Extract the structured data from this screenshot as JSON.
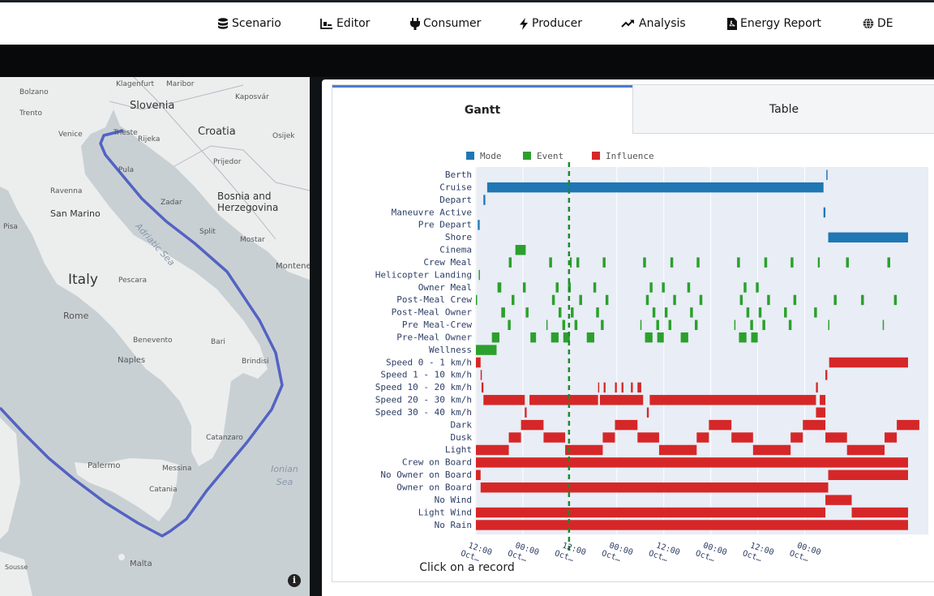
{
  "nav": {
    "items": [
      {
        "label": "Scenario",
        "icon": "database-icon"
      },
      {
        "label": "Editor",
        "icon": "chart-editor-icon"
      },
      {
        "label": "Consumer",
        "icon": "plug-icon"
      },
      {
        "label": "Producer",
        "icon": "bolt-icon"
      },
      {
        "label": "Analysis",
        "icon": "trend-icon"
      },
      {
        "label": "Energy Report",
        "icon": "pdf-file-icon"
      },
      {
        "label": "DE",
        "icon": "globe-icon"
      }
    ]
  },
  "map": {
    "labels": [
      "Klagenfurt",
      "Maribor",
      "Bolzano",
      "Trento",
      "Slovenia",
      "Kaposvár",
      "Croatia",
      "Osijek",
      "Venice",
      "Trieste",
      "Rijeka",
      "Prijedor",
      "Pula",
      "Ravenna",
      "Zadar",
      "Bosnia and Herzegovina",
      "San Marino",
      "Adriatic Sea",
      "Split",
      "Mostar",
      "Pisa",
      "Montenegro",
      "Italy",
      "Pescara",
      "Rome",
      "Benevento",
      "Bari",
      "Naples",
      "Brindisi",
      "Catanzaro",
      "Palermo",
      "Messina",
      "Ionian Sea",
      "Catania",
      "Malta",
      "Sousse"
    ],
    "route_color": "#5363c2",
    "info_icon": "info-icon"
  },
  "tabs": {
    "gantt": "Gantt",
    "table": "Table"
  },
  "chart_data": {
    "type": "gantt",
    "legend": [
      {
        "name": "Mode",
        "color": "#1f77b4"
      },
      {
        "name": "Event",
        "color": "#2ca02c"
      },
      {
        "name": "Influence",
        "color": "#d62728"
      }
    ],
    "legend_placement": "top",
    "categories": [
      "Berth",
      "Cruise",
      "Depart",
      "Maneuvre Active",
      "Pre Depart",
      "Shore",
      "Cinema",
      "Crew Meal",
      "Helicopter Landing",
      "Owner Meal",
      "Post-Meal Crew",
      "Post-Meal Owner",
      "Pre Meal-Crew",
      "Pre-Meal Owner",
      "Wellness",
      "Speed 0 - 1 km/h",
      "Speed 1 - 10 km/h",
      "Speed 10 - 20 km/h",
      "Speed 20 - 30 km/h",
      "Speed 30 - 40 km/h",
      "Dark",
      "Dusk",
      "Light",
      "Crew on Board",
      "No Owner on Board",
      "Owner on Board",
      "No Wind",
      "Light Wind",
      "No Rain"
    ],
    "x_ticks": [
      "12:00 Oct…",
      "00:00 Oct…",
      "12:00 Oct…",
      "00:00 Oct…",
      "12:00 Oct…",
      "00:00 Oct…",
      "12:00 Oct…",
      "00:00 Oct…"
    ],
    "marker_tick": "12:00 Oct…",
    "grid": true,
    "tasks": [
      {
        "row": "Berth",
        "type": "Mode",
        "start": 3.73,
        "end": 3.74
      },
      {
        "row": "Cruise",
        "type": "Mode",
        "start": 0.12,
        "end": 3.7
      },
      {
        "row": "Depart",
        "type": "Mode",
        "start": 0.08,
        "end": 0.1
      },
      {
        "row": "Maneuvre Active",
        "type": "Mode",
        "start": 3.7,
        "end": 3.72
      },
      {
        "row": "Pre Depart",
        "type": "Mode",
        "start": 0.02,
        "end": 0.04
      },
      {
        "row": "Shore",
        "type": "Mode",
        "start": 3.75,
        "end": 4.6
      },
      {
        "row": "Cinema",
        "type": "Event",
        "start": 0.42,
        "end": 0.53
      },
      {
        "row": "Crew Meal",
        "type": "Event",
        "start": 0.35,
        "end": 0.38
      },
      {
        "row": "Crew Meal",
        "type": "Event",
        "start": 0.78,
        "end": 0.81
      },
      {
        "row": "Crew Meal",
        "type": "Event",
        "start": 1.0,
        "end": 1.02
      },
      {
        "row": "Crew Meal",
        "type": "Event",
        "start": 1.07,
        "end": 1.1
      },
      {
        "row": "Crew Meal",
        "type": "Event",
        "start": 1.35,
        "end": 1.38
      },
      {
        "row": "Crew Meal",
        "type": "Event",
        "start": 1.78,
        "end": 1.81
      },
      {
        "row": "Crew Meal",
        "type": "Event",
        "start": 2.07,
        "end": 2.1
      },
      {
        "row": "Crew Meal",
        "type": "Event",
        "start": 2.35,
        "end": 2.38
      },
      {
        "row": "Crew Meal",
        "type": "Event",
        "start": 2.78,
        "end": 2.81
      },
      {
        "row": "Crew Meal",
        "type": "Event",
        "start": 3.07,
        "end": 3.1
      },
      {
        "row": "Crew Meal",
        "type": "Event",
        "start": 3.35,
        "end": 3.38
      },
      {
        "row": "Crew Meal",
        "type": "Event",
        "start": 3.64,
        "end": 3.66
      },
      {
        "row": "Crew Meal",
        "type": "Event",
        "start": 3.94,
        "end": 3.97
      },
      {
        "row": "Crew Meal",
        "type": "Event",
        "start": 4.38,
        "end": 4.41
      },
      {
        "row": "Helicopter Landing",
        "type": "Event",
        "start": 0.03,
        "end": 0.04
      },
      {
        "row": "Owner Meal",
        "type": "Event",
        "start": 0.23,
        "end": 0.27
      },
      {
        "row": "Owner Meal",
        "type": "Event",
        "start": 0.5,
        "end": 0.53
      },
      {
        "row": "Owner Meal",
        "type": "Event",
        "start": 0.85,
        "end": 0.88
      },
      {
        "row": "Owner Meal",
        "type": "Event",
        "start": 0.98,
        "end": 1.01
      },
      {
        "row": "Owner Meal",
        "type": "Event",
        "start": 1.25,
        "end": 1.28
      },
      {
        "row": "Owner Meal",
        "type": "Event",
        "start": 1.85,
        "end": 1.88
      },
      {
        "row": "Owner Meal",
        "type": "Event",
        "start": 1.98,
        "end": 2.01
      },
      {
        "row": "Owner Meal",
        "type": "Event",
        "start": 2.25,
        "end": 2.28
      },
      {
        "row": "Owner Meal",
        "type": "Event",
        "start": 2.85,
        "end": 2.88
      },
      {
        "row": "Owner Meal",
        "type": "Event",
        "start": 2.98,
        "end": 3.01
      },
      {
        "row": "Post-Meal Crew",
        "type": "Event",
        "start": 0.0,
        "end": 0.01
      },
      {
        "row": "Post-Meal Crew",
        "type": "Event",
        "start": 0.38,
        "end": 0.41
      },
      {
        "row": "Post-Meal Crew",
        "type": "Event",
        "start": 0.81,
        "end": 0.84
      },
      {
        "row": "Post-Meal Crew",
        "type": "Event",
        "start": 1.1,
        "end": 1.13
      },
      {
        "row": "Post-Meal Crew",
        "type": "Event",
        "start": 1.38,
        "end": 1.41
      },
      {
        "row": "Post-Meal Crew",
        "type": "Event",
        "start": 1.81,
        "end": 1.84
      },
      {
        "row": "Post-Meal Crew",
        "type": "Event",
        "start": 2.1,
        "end": 2.13
      },
      {
        "row": "Post-Meal Crew",
        "type": "Event",
        "start": 2.38,
        "end": 2.41
      },
      {
        "row": "Post-Meal Crew",
        "type": "Event",
        "start": 2.81,
        "end": 2.84
      },
      {
        "row": "Post-Meal Crew",
        "type": "Event",
        "start": 3.1,
        "end": 3.13
      },
      {
        "row": "Post-Meal Crew",
        "type": "Event",
        "start": 3.38,
        "end": 3.41
      },
      {
        "row": "Post-Meal Crew",
        "type": "Event",
        "start": 3.81,
        "end": 3.84
      },
      {
        "row": "Post-Meal Crew",
        "type": "Event",
        "start": 4.1,
        "end": 4.13
      },
      {
        "row": "Post-Meal Crew",
        "type": "Event",
        "start": 4.45,
        "end": 4.48
      },
      {
        "row": "Post-Meal Owner",
        "type": "Event",
        "start": 0.27,
        "end": 0.31
      },
      {
        "row": "Post-Meal Owner",
        "type": "Event",
        "start": 0.53,
        "end": 0.56
      },
      {
        "row": "Post-Meal Owner",
        "type": "Event",
        "start": 0.88,
        "end": 0.91
      },
      {
        "row": "Post-Meal Owner",
        "type": "Event",
        "start": 1.01,
        "end": 1.04
      },
      {
        "row": "Post-Meal Owner",
        "type": "Event",
        "start": 1.28,
        "end": 1.31
      },
      {
        "row": "Post-Meal Owner",
        "type": "Event",
        "start": 1.88,
        "end": 1.91
      },
      {
        "row": "Post-Meal Owner",
        "type": "Event",
        "start": 2.01,
        "end": 2.04
      },
      {
        "row": "Post-Meal Owner",
        "type": "Event",
        "start": 2.28,
        "end": 2.31
      },
      {
        "row": "Post-Meal Owner",
        "type": "Event",
        "start": 2.88,
        "end": 2.91
      },
      {
        "row": "Post-Meal Owner",
        "type": "Event",
        "start": 3.01,
        "end": 3.04
      },
      {
        "row": "Post-Meal Owner",
        "type": "Event",
        "start": 3.28,
        "end": 3.31
      },
      {
        "row": "Post-Meal Owner",
        "type": "Event",
        "start": 3.6,
        "end": 3.63
      },
      {
        "row": "Pre Meal-Crew",
        "type": "Event",
        "start": 0.34,
        "end": 0.37
      },
      {
        "row": "Pre Meal-Crew",
        "type": "Event",
        "start": 0.75,
        "end": 0.76
      },
      {
        "row": "Pre Meal-Crew",
        "type": "Event",
        "start": 0.92,
        "end": 0.95
      },
      {
        "row": "Pre Meal-Crew",
        "type": "Event",
        "start": 1.05,
        "end": 1.08
      },
      {
        "row": "Pre Meal-Crew",
        "type": "Event",
        "start": 1.33,
        "end": 1.36
      },
      {
        "row": "Pre Meal-Crew",
        "type": "Event",
        "start": 1.75,
        "end": 1.76
      },
      {
        "row": "Pre Meal-Crew",
        "type": "Event",
        "start": 1.92,
        "end": 1.95
      },
      {
        "row": "Pre Meal-Crew",
        "type": "Event",
        "start": 2.05,
        "end": 2.08
      },
      {
        "row": "Pre Meal-Crew",
        "type": "Event",
        "start": 2.33,
        "end": 2.36
      },
      {
        "row": "Pre Meal-Crew",
        "type": "Event",
        "start": 2.75,
        "end": 2.76
      },
      {
        "row": "Pre Meal-Crew",
        "type": "Event",
        "start": 2.92,
        "end": 2.95
      },
      {
        "row": "Pre Meal-Crew",
        "type": "Event",
        "start": 3.05,
        "end": 3.08
      },
      {
        "row": "Pre Meal-Crew",
        "type": "Event",
        "start": 3.33,
        "end": 3.36
      },
      {
        "row": "Pre Meal-Crew",
        "type": "Event",
        "start": 3.75,
        "end": 3.76
      },
      {
        "row": "Pre Meal-Crew",
        "type": "Event",
        "start": 4.33,
        "end": 4.34
      },
      {
        "row": "Pre-Meal Owner",
        "type": "Event",
        "start": 0.17,
        "end": 0.25
      },
      {
        "row": "Pre-Meal Owner",
        "type": "Event",
        "start": 0.58,
        "end": 0.64
      },
      {
        "row": "Pre-Meal Owner",
        "type": "Event",
        "start": 0.8,
        "end": 0.88
      },
      {
        "row": "Pre-Meal Owner",
        "type": "Event",
        "start": 0.93,
        "end": 1.0
      },
      {
        "row": "Pre-Meal Owner",
        "type": "Event",
        "start": 1.18,
        "end": 1.26
      },
      {
        "row": "Pre-Meal Owner",
        "type": "Event",
        "start": 1.8,
        "end": 1.88
      },
      {
        "row": "Pre-Meal Owner",
        "type": "Event",
        "start": 1.93,
        "end": 2.0
      },
      {
        "row": "Pre-Meal Owner",
        "type": "Event",
        "start": 2.18,
        "end": 2.26
      },
      {
        "row": "Pre-Meal Owner",
        "type": "Event",
        "start": 2.8,
        "end": 2.88
      },
      {
        "row": "Pre-Meal Owner",
        "type": "Event",
        "start": 2.93,
        "end": 3.0
      },
      {
        "row": "Wellness",
        "type": "Event",
        "start": 0.0,
        "end": 0.22
      },
      {
        "row": "Speed 0 - 1 km/h",
        "type": "Influence",
        "start": 0.0,
        "end": 0.05
      },
      {
        "row": "Speed 0 - 1 km/h",
        "type": "Influence",
        "start": 3.76,
        "end": 4.6
      },
      {
        "row": "Speed 1 - 10 km/h",
        "type": "Influence",
        "start": 0.05,
        "end": 0.06
      },
      {
        "row": "Speed 1 - 10 km/h",
        "type": "Influence",
        "start": 3.72,
        "end": 3.74
      },
      {
        "row": "Speed 10 - 20 km/h",
        "type": "Influence",
        "start": 0.06,
        "end": 0.08
      },
      {
        "row": "Speed 10 - 20 km/h",
        "type": "Influence",
        "start": 1.3,
        "end": 1.31
      },
      {
        "row": "Speed 10 - 20 km/h",
        "type": "Influence",
        "start": 1.36,
        "end": 1.38
      },
      {
        "row": "Speed 10 - 20 km/h",
        "type": "Influence",
        "start": 1.48,
        "end": 1.5
      },
      {
        "row": "Speed 10 - 20 km/h",
        "type": "Influence",
        "start": 1.55,
        "end": 1.57
      },
      {
        "row": "Speed 10 - 20 km/h",
        "type": "Influence",
        "start": 1.65,
        "end": 1.67
      },
      {
        "row": "Speed 10 - 20 km/h",
        "type": "Influence",
        "start": 1.72,
        "end": 1.76
      },
      {
        "row": "Speed 10 - 20 km/h",
        "type": "Influence",
        "start": 3.62,
        "end": 3.64
      },
      {
        "row": "Speed 20 - 30 km/h",
        "type": "Influence",
        "start": 0.08,
        "end": 0.52
      },
      {
        "row": "Speed 20 - 30 km/h",
        "type": "Influence",
        "start": 0.57,
        "end": 1.3
      },
      {
        "row": "Speed 20 - 30 km/h",
        "type": "Influence",
        "start": 1.32,
        "end": 1.78
      },
      {
        "row": "Speed 20 - 30 km/h",
        "type": "Influence",
        "start": 1.85,
        "end": 3.62
      },
      {
        "row": "Speed 20 - 30 km/h",
        "type": "Influence",
        "start": 3.66,
        "end": 3.72
      },
      {
        "row": "Speed 30 - 40 km/h",
        "type": "Influence",
        "start": 0.52,
        "end": 0.54
      },
      {
        "row": "Speed 30 - 40 km/h",
        "type": "Influence",
        "start": 1.82,
        "end": 1.84
      },
      {
        "row": "Speed 30 - 40 km/h",
        "type": "Influence",
        "start": 3.62,
        "end": 3.72
      },
      {
        "row": "Dark",
        "type": "Influence",
        "start": 0.48,
        "end": 0.72
      },
      {
        "row": "Dark",
        "type": "Influence",
        "start": 1.48,
        "end": 1.72
      },
      {
        "row": "Dark",
        "type": "Influence",
        "start": 2.48,
        "end": 2.72
      },
      {
        "row": "Dark",
        "type": "Influence",
        "start": 3.48,
        "end": 3.72
      },
      {
        "row": "Dark",
        "type": "Influence",
        "start": 4.48,
        "end": 4.72
      },
      {
        "row": "Dusk",
        "type": "Influence",
        "start": 0.35,
        "end": 0.48
      },
      {
        "row": "Dusk",
        "type": "Influence",
        "start": 0.72,
        "end": 0.95
      },
      {
        "row": "Dusk",
        "type": "Influence",
        "start": 1.35,
        "end": 1.48
      },
      {
        "row": "Dusk",
        "type": "Influence",
        "start": 1.72,
        "end": 1.95
      },
      {
        "row": "Dusk",
        "type": "Influence",
        "start": 2.35,
        "end": 2.48
      },
      {
        "row": "Dusk",
        "type": "Influence",
        "start": 2.72,
        "end": 2.95
      },
      {
        "row": "Dusk",
        "type": "Influence",
        "start": 3.35,
        "end": 3.48
      },
      {
        "row": "Dusk",
        "type": "Influence",
        "start": 3.72,
        "end": 3.95
      },
      {
        "row": "Dusk",
        "type": "Influence",
        "start": 4.35,
        "end": 4.48
      },
      {
        "row": "Light",
        "type": "Influence",
        "start": 0.0,
        "end": 0.35
      },
      {
        "row": "Light",
        "type": "Influence",
        "start": 0.95,
        "end": 1.35
      },
      {
        "row": "Light",
        "type": "Influence",
        "start": 1.95,
        "end": 2.35
      },
      {
        "row": "Light",
        "type": "Influence",
        "start": 2.95,
        "end": 3.35
      },
      {
        "row": "Light",
        "type": "Influence",
        "start": 3.95,
        "end": 4.35
      },
      {
        "row": "Crew on Board",
        "type": "Influence",
        "start": 0.0,
        "end": 4.6
      },
      {
        "row": "No Owner on Board",
        "type": "Influence",
        "start": 0.0,
        "end": 0.05
      },
      {
        "row": "No Owner on Board",
        "type": "Influence",
        "start": 3.75,
        "end": 4.6
      },
      {
        "row": "Owner on Board",
        "type": "Influence",
        "start": 0.05,
        "end": 3.75
      },
      {
        "row": "No Wind",
        "type": "Influence",
        "start": 3.72,
        "end": 4.0
      },
      {
        "row": "Light Wind",
        "type": "Influence",
        "start": 0.0,
        "end": 3.72
      },
      {
        "row": "Light Wind",
        "type": "Influence",
        "start": 4.0,
        "end": 4.6
      },
      {
        "row": "No Rain",
        "type": "Influence",
        "start": 0.0,
        "end": 4.6
      }
    ]
  },
  "caption": "Click on a record"
}
